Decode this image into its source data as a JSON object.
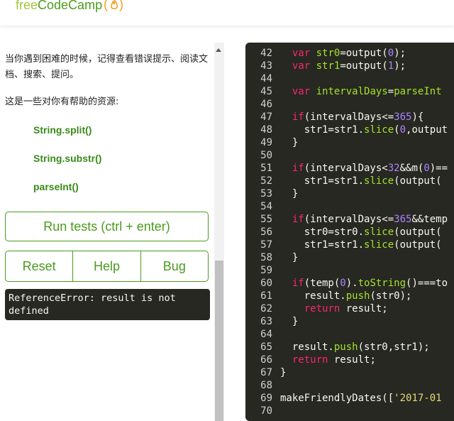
{
  "header": {
    "logo_text": "freeCodeCamp",
    "logo_free": "free",
    "logo_camp": "CodeCamp",
    "logo_paren_open": "(",
    "logo_paren_close": ")"
  },
  "instructions": {
    "hint_text": "当你遇到困难的时候，记得查看错误提示、阅读文档、搜索、提问。",
    "resources_text": "这是一些对你有帮助的资源:",
    "links": [
      "String.split()",
      "String.substr()",
      "parseInt()"
    ]
  },
  "buttons": {
    "run": "Run tests (ctrl + enter)",
    "reset": "Reset",
    "help": "Help",
    "bug": "Bug"
  },
  "output": {
    "text": "ReferenceError: result is not defined"
  },
  "editor": {
    "lines": [
      {
        "n": "42",
        "t": "  var str0=output(0);"
      },
      {
        "n": "43",
        "t": "  var str1=output(1);"
      },
      {
        "n": "44",
        "t": ""
      },
      {
        "n": "45",
        "t": "  var intervalDays=parseInt"
      },
      {
        "n": "46",
        "t": ""
      },
      {
        "n": "47",
        "t": "  if(intervalDays<=365){"
      },
      {
        "n": "48",
        "t": "    str1=str1.slice(0,output"
      },
      {
        "n": "49",
        "t": "  }"
      },
      {
        "n": "50",
        "t": ""
      },
      {
        "n": "51",
        "t": "  if(intervalDays<32&&m(0)=="
      },
      {
        "n": "52",
        "t": "    str1=str1.slice(output("
      },
      {
        "n": "53",
        "t": "  }"
      },
      {
        "n": "54",
        "t": ""
      },
      {
        "n": "55",
        "t": "  if(intervalDays<=365&&temp"
      },
      {
        "n": "56",
        "t": "    str0=str0.slice(output("
      },
      {
        "n": "57",
        "t": "    str1=str1.slice(output("
      },
      {
        "n": "58",
        "t": "  }"
      },
      {
        "n": "59",
        "t": ""
      },
      {
        "n": "60",
        "t": "  if(temp(0).toString()===to"
      },
      {
        "n": "61",
        "t": "    result.push(str0);"
      },
      {
        "n": "62",
        "t": "    return result;"
      },
      {
        "n": "63",
        "t": "  }"
      },
      {
        "n": "64",
        "t": ""
      },
      {
        "n": "65",
        "t": "  result.push(str0,str1);"
      },
      {
        "n": "66",
        "t": "  return result;"
      },
      {
        "n": "67",
        "t": "}"
      },
      {
        "n": "68",
        "t": ""
      },
      {
        "n": "69",
        "t": "makeFriendlyDates(['2017-01"
      },
      {
        "n": "70",
        "t": ""
      }
    ]
  },
  "colors": {
    "brand_green": "#4b9a1e",
    "editor_bg": "#272822",
    "keyword": "#f92672",
    "function": "#a6e22e",
    "number": "#ae81ff",
    "string": "#e6db74"
  }
}
